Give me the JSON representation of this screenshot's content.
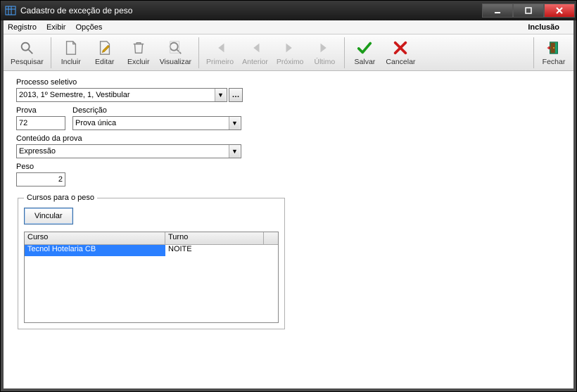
{
  "window": {
    "title": "Cadastro de exceção de peso"
  },
  "menubar": {
    "items": [
      "Registro",
      "Exibir",
      "Opções"
    ],
    "mode": "Inclusão"
  },
  "toolbar": {
    "pesquisar": "Pesquisar",
    "incluir": "Incluir",
    "editar": "Editar",
    "excluir": "Excluir",
    "visualizar": "Visualizar",
    "primeiro": "Primeiro",
    "anterior": "Anterior",
    "proximo": "Próximo",
    "ultimo": "Último",
    "salvar": "Salvar",
    "cancelar": "Cancelar",
    "fechar": "Fechar"
  },
  "form": {
    "processo_label": "Processo seletivo",
    "processo_value": "2013, 1º Semestre, 1, Vestibular",
    "prova_label": "Prova",
    "prova_value": "72",
    "descricao_label": "Descrição",
    "descricao_value": "Prova única",
    "conteudo_label": "Conteúdo da prova",
    "conteudo_value": "Expressão",
    "peso_label": "Peso",
    "peso_value": "2"
  },
  "cursos": {
    "legend": "Cursos para o peso",
    "vincular_label": "Vincular",
    "columns": {
      "curso": "Curso",
      "turno": "Turno"
    },
    "rows": [
      {
        "curso": "Tecnol Hotelaria CB",
        "turno": "NOITE"
      }
    ]
  }
}
